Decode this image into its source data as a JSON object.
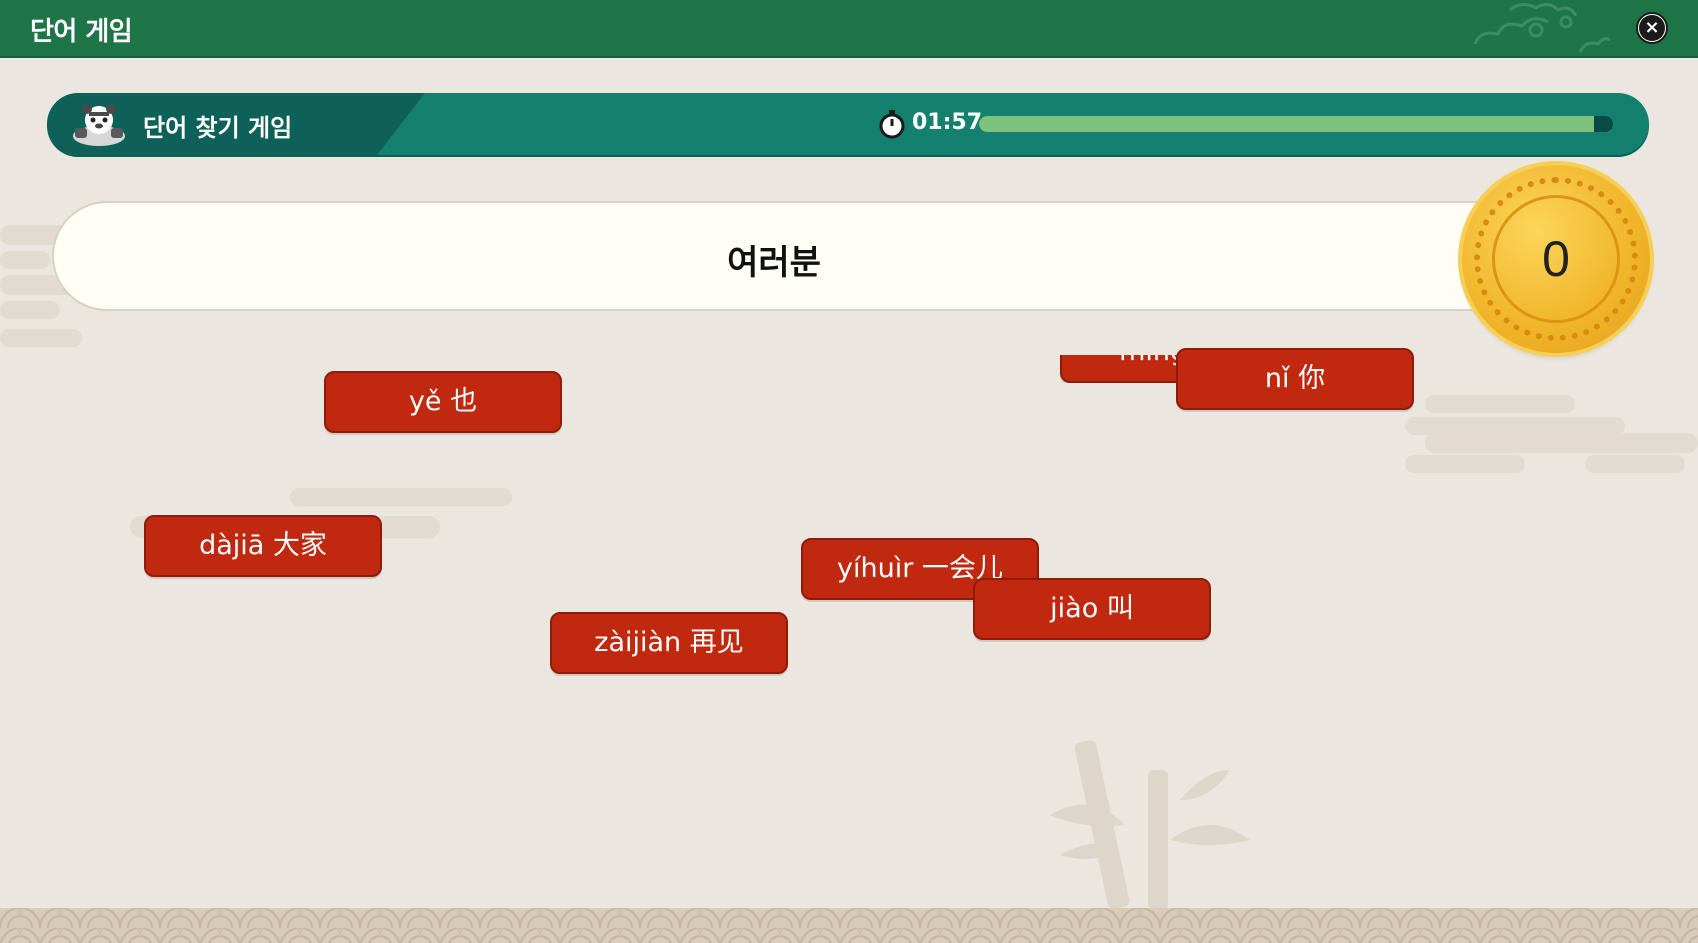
{
  "window": {
    "title": "단어 게임",
    "close_label": "×"
  },
  "game_bar": {
    "title": "단어 찾기 게임",
    "timer": "01:57",
    "progress_percent": 97
  },
  "prompt": {
    "word": "여러분"
  },
  "score": "0",
  "tiles": {
    "ye": "yě 也",
    "mingtian_partial": "míngtiān",
    "ni": "nǐ 你",
    "dajia": "dàjiā 大家",
    "yihuir": "yíhuìr 一会儿",
    "jiao": "jiào 叫",
    "zaijian": "zàijiàn 再见"
  },
  "colors": {
    "title_bar": "#1e7548",
    "game_bar": "#138070",
    "tile": "#c0290f",
    "coin": "#f1b62c",
    "background": "#ebe6df"
  }
}
